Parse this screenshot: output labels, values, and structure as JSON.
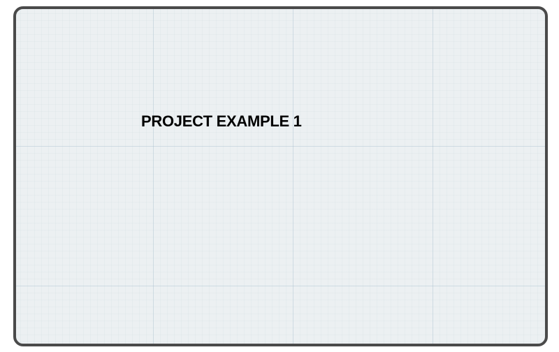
{
  "canvas": {
    "background_color": "#ecf0f2",
    "border_color": "#4a4a4a"
  },
  "project": {
    "title": "PROJECT EXAMPLE 1"
  }
}
